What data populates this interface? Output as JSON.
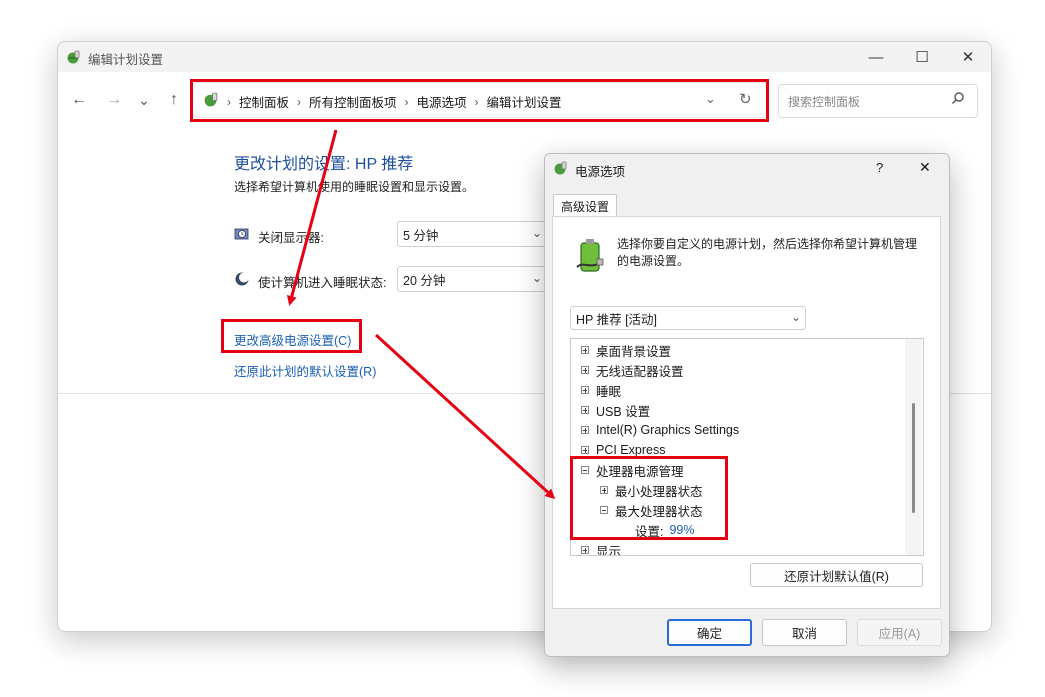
{
  "main_window": {
    "title": "编辑计划设置",
    "window_controls": {
      "minimize": "—",
      "maximize": "☐",
      "close": "✕"
    },
    "nav": {
      "back": "←",
      "forward": "→",
      "recent": "⌄",
      "up": "↑"
    },
    "breadcrumb": [
      "控制面板",
      "所有控制面板项",
      "电源选项",
      "编辑计划设置"
    ],
    "search_placeholder": "搜索控制面板",
    "heading": "更改计划的设置: HP 推荐",
    "subheading": "选择希望计算机使用的睡眠设置和显示设置。",
    "settings": [
      {
        "label": "关闭显示器:",
        "value": "5 分钟",
        "icon": "monitor-clock-icon"
      },
      {
        "label": "使计算机进入睡眠状态:",
        "value": "20 分钟",
        "icon": "moon-icon"
      }
    ],
    "links": {
      "advanced": "更改高级电源设置(C)",
      "restore": "还原此计划的默认设置(R)"
    }
  },
  "dialog": {
    "title": "电源选项",
    "help": "?",
    "close": "✕",
    "tab": "高级设置",
    "description": "选择你要自定义的电源计划，然后选择你希望计算机管理的电源设置。",
    "plan_select": "HP 推荐 [活动]",
    "tree": [
      {
        "label": "桌面背景设置",
        "level": 0,
        "expander": "plus"
      },
      {
        "label": "无线适配器设置",
        "level": 0,
        "expander": "plus"
      },
      {
        "label": "睡眠",
        "level": 0,
        "expander": "plus"
      },
      {
        "label": "USB 设置",
        "level": 0,
        "expander": "plus"
      },
      {
        "label": "Intel(R) Graphics Settings",
        "level": 0,
        "expander": "plus"
      },
      {
        "label": "PCI Express",
        "level": 0,
        "expander": "plus"
      },
      {
        "label": "处理器电源管理",
        "level": 0,
        "expander": "minus"
      },
      {
        "label": "最小处理器状态",
        "level": 1,
        "expander": "plus"
      },
      {
        "label": "最大处理器状态",
        "level": 1,
        "expander": "minus"
      },
      {
        "label": "设置:",
        "value": "99%",
        "level": 2,
        "expander": "none"
      },
      {
        "label": "显示",
        "level": 0,
        "expander": "plus"
      }
    ],
    "restore_button": "还原计划默认值(R)",
    "buttons": {
      "ok": "确定",
      "cancel": "取消",
      "apply": "应用(A)"
    }
  },
  "colors": {
    "accent_link": "#1a5fb4",
    "highlight_red": "#e60012",
    "heading_blue": "#1e4f9f"
  }
}
